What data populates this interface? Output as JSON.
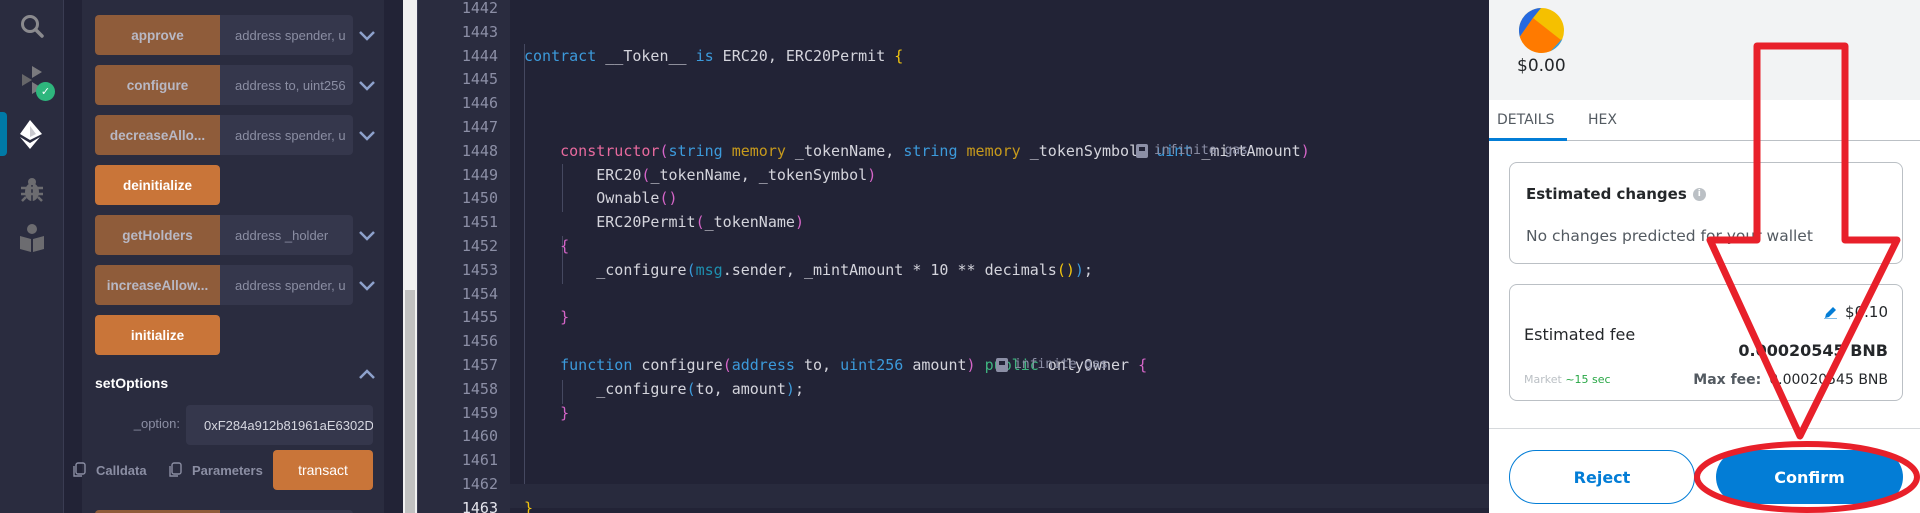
{
  "iconbar": {
    "items": [
      {
        "name": "search",
        "icon": "search-icon"
      },
      {
        "name": "solidity-compiler",
        "icon": "compiler-icon",
        "badge": "✓"
      },
      {
        "name": "deploy-run",
        "icon": "ethereum-deploy-icon",
        "active": true
      },
      {
        "name": "debugger",
        "icon": "bug-icon"
      },
      {
        "name": "learneth",
        "icon": "book-reader-icon"
      }
    ]
  },
  "panel": {
    "functions": [
      {
        "label": "approve",
        "params": "address spender, u",
        "type": "input"
      },
      {
        "label": "configure",
        "params": "address to, uint256",
        "type": "input"
      },
      {
        "label": "decreaseAllo...",
        "params": "address spender, u",
        "type": "input"
      },
      {
        "label": "deinitialize",
        "type": "solo"
      },
      {
        "label": "getHolders",
        "params": "address _holder",
        "type": "input"
      },
      {
        "label": "increaseAllow...",
        "params": "address spender, u",
        "type": "input"
      },
      {
        "label": "initialize",
        "type": "solo"
      }
    ],
    "expanded": {
      "title": "setOptions",
      "param_label": "_option:",
      "param_value": "0xF284a912b81961aE6302D",
      "calldata_label": "Calldata",
      "parameters_label": "Parameters",
      "transact_label": "transact"
    }
  },
  "editor": {
    "lines": [
      {
        "n": "1442",
        "html": ""
      },
      {
        "n": "1443",
        "html": ""
      },
      {
        "n": "1444",
        "html": "<span class='k-blue'>contract</span> __Token__ <span class='k-blue'>is</span> ERC20, ERC20Permit <span class='br-y'>{</span>"
      },
      {
        "n": "1445",
        "html": ""
      },
      {
        "n": "1446",
        "html": ""
      },
      {
        "n": "1447",
        "html": ""
      },
      {
        "n": "1448",
        "html": "    <span class='k-pink'>constructor</span><span class='br-p'>(</span><span class='k-blue'>string</span> <span class='k-gold'>memory</span> _tokenName, <span class='k-blue'>string</span> <span class='k-gold'>memory</span> _tokenSymbol, <span class='k-blue'>uint</span> _mintAmount<span class='br-p'>)</span>"
      },
      {
        "n": "1449",
        "html": "        ERC20<span class='br-p'>(</span>_tokenName, _tokenSymbol<span class='br-p'>)</span>"
      },
      {
        "n": "1450",
        "html": "        Ownable<span class='br-p'>()</span>"
      },
      {
        "n": "1451",
        "html": "        ERC20Permit<span class='br-p'>(</span>_tokenName<span class='br-p'>)</span>"
      },
      {
        "n": "1452",
        "html": "    <span class='br-p'>{</span>"
      },
      {
        "n": "1453",
        "html": "        _configure<span class='br-b'>(</span><span class='k-msg'>msg</span>.sender, _mintAmount * 10 ** decimals<span class='br-y'>()</span><span class='br-b'>)</span>;"
      },
      {
        "n": "1454",
        "html": ""
      },
      {
        "n": "1455",
        "html": "    <span class='br-p'>}</span>"
      },
      {
        "n": "1456",
        "html": ""
      },
      {
        "n": "1457",
        "html": "    <span class='k-blue'>function</span> configure<span class='br-p'>(</span><span class='k-blue'>address</span> to, <span class='k-blue'>uint256</span> amount<span class='br-p'>)</span> <span class='k-green'>public</span> onlyOwner <span class='br-p'>{</span>"
      },
      {
        "n": "1458",
        "html": "        _configure<span class='br-b'>(</span>to, amount<span class='br-b'>)</span>;"
      },
      {
        "n": "1459",
        "html": "    <span class='br-p'>}</span>"
      },
      {
        "n": "1460",
        "html": ""
      },
      {
        "n": "1461",
        "html": ""
      },
      {
        "n": "1462",
        "html": ""
      },
      {
        "n": "1463",
        "html": "<span class='br-y'>}</span>",
        "active": true
      }
    ],
    "gas_hints": [
      {
        "line": "1448",
        "text": "infinite gas"
      },
      {
        "line": "1457",
        "text": "infinite gas"
      }
    ]
  },
  "metamask": {
    "amount": "$0.00",
    "tabs": [
      "DETAILS",
      "HEX"
    ],
    "active_tab": "DETAILS",
    "estimated_changes": {
      "title": "Estimated changes",
      "text": "No changes predicted for your wallet"
    },
    "fee": {
      "label": "Estimated fee",
      "usd": "$0.10",
      "native": "0.00020545 BNB",
      "market_label": "Market",
      "market_time": "~15 sec",
      "max_fee_label": "Max fee:",
      "max_fee_value": "0.00020545 BNB"
    },
    "buttons": {
      "reject": "Reject",
      "confirm": "Confirm"
    },
    "colors": {
      "primary": "#037dd6",
      "annotation": "#e8202a"
    }
  }
}
